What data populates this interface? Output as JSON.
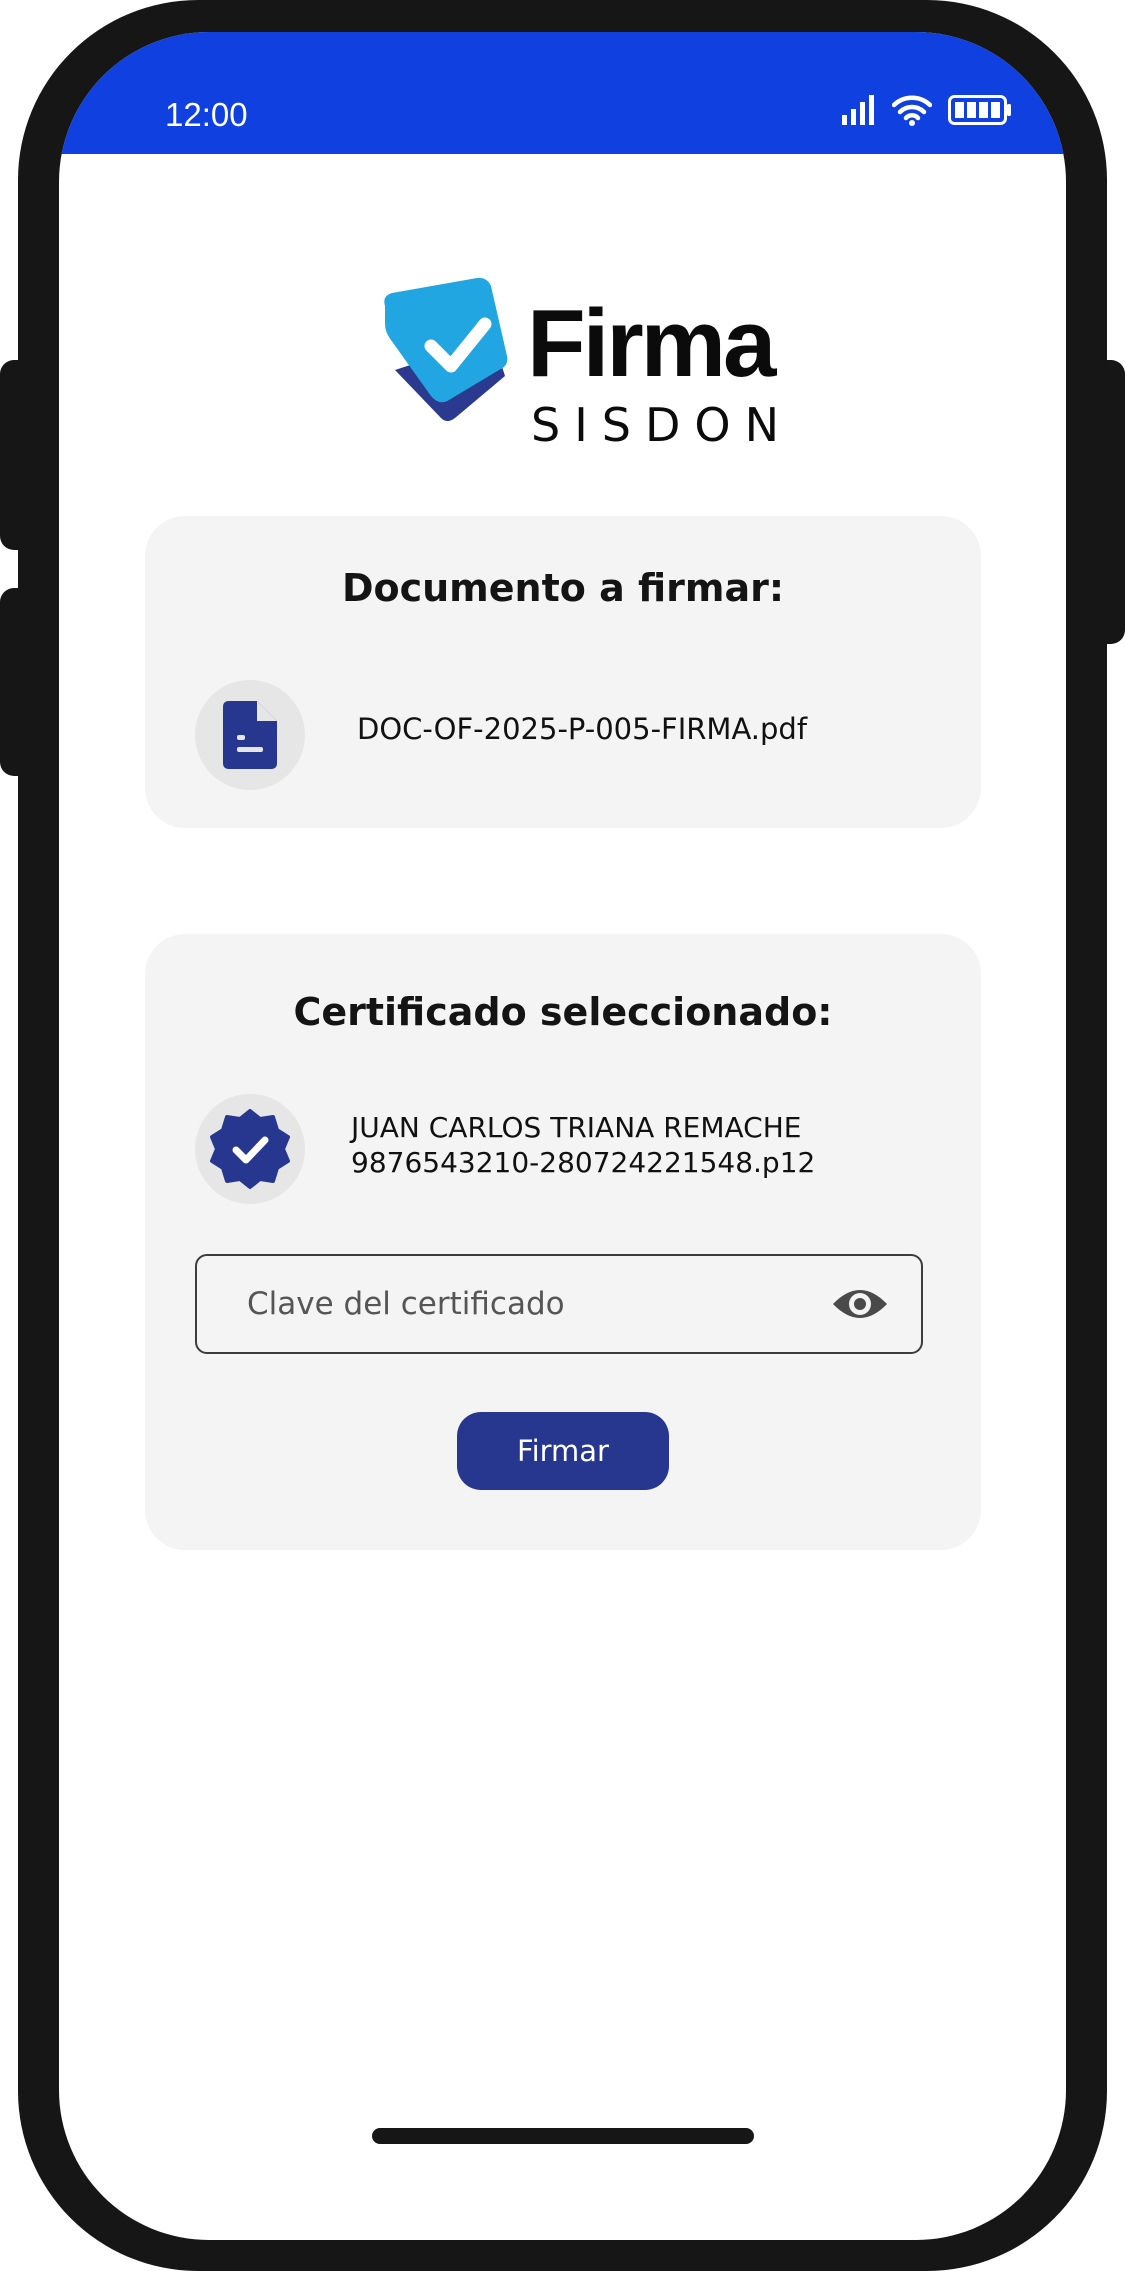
{
  "status_bar": {
    "time": "12:00",
    "icons": [
      "signal-icon",
      "wifi-icon",
      "battery-icon"
    ]
  },
  "logo": {
    "word": "Firma",
    "subword": "SISDON",
    "icon": "checkmark-document-icon"
  },
  "document_card": {
    "title": "Documento a firmar:",
    "icon": "document-icon",
    "filename": "DOC-OF-2025-P-005-FIRMA.pdf"
  },
  "certificate_card": {
    "title": "Certificado seleccionado:",
    "icon": "verified-badge-icon",
    "holder": "JUAN CARLOS TRIANA REMACHE",
    "file": "9876543210-280724221548.p12",
    "password_field": {
      "value": "",
      "placeholder": "Clave del certificado",
      "toggle_icon": "eye-icon"
    },
    "sign_button_label": "Firmar"
  },
  "colors": {
    "status_bar": "#1040e0",
    "accent": "#27378f",
    "logo_light_blue": "#22a6e2",
    "card_bg": "#f4f4f4",
    "phone_frame": "#161616"
  }
}
